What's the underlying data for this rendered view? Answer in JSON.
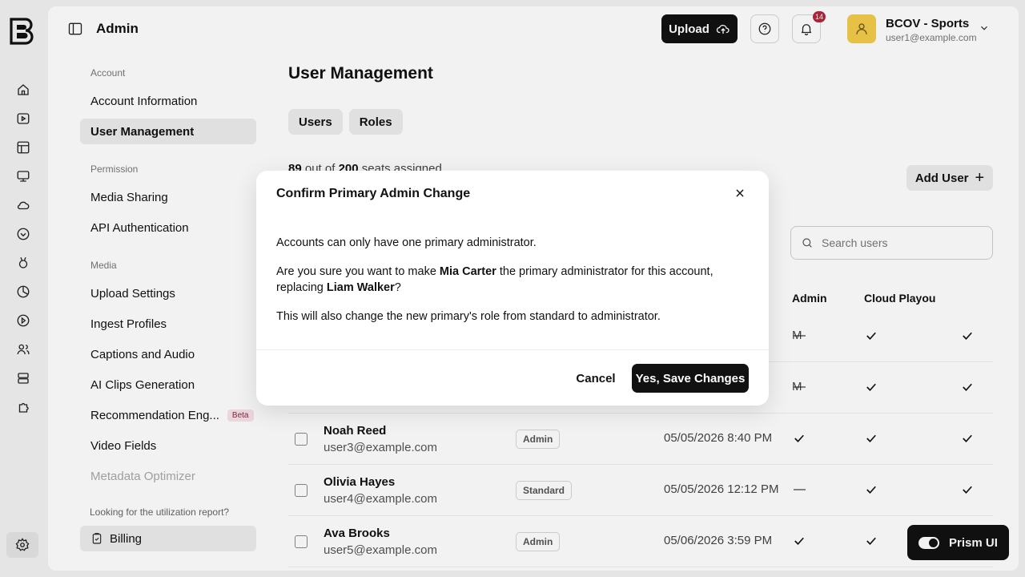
{
  "header": {
    "title": "Admin",
    "upload_label": "Upload",
    "notifications_count": "14",
    "account_name": "BCOV - Sports",
    "account_email": "user1@example.com"
  },
  "settings_nav": {
    "account_section": "Account",
    "account_information": "Account Information",
    "user_management": "User Management",
    "permission_section": "Permission",
    "media_sharing": "Media Sharing",
    "api_authentication": "API Authentication",
    "media_section": "Media",
    "upload_settings": "Upload Settings",
    "ingest_profiles": "Ingest Profiles",
    "captions_and_audio": "Captions and Audio",
    "ai_clips": "AI Clips Generation",
    "recommendation": "Recommendation Eng...",
    "beta_label": "Beta",
    "video_fields": "Video Fields",
    "metadata_optimizer": "Metadata Optimizer",
    "utilization_note": "Looking for the utilization report?",
    "billing": "Billing"
  },
  "main": {
    "page_title": "User Management",
    "tabs": [
      "Users",
      "Roles"
    ],
    "seats_assigned": "89",
    "seats_total": "200",
    "seats_prefix": "out of",
    "seats_suffix": "seats assigned",
    "add_user_label": "Add User",
    "search_placeholder": "Search users",
    "columns": {
      "admin": "Admin",
      "cloud_playout": "Cloud Playou"
    },
    "partial_rows": [
      {
        "date_tail": "M",
        "admin": "—"
      },
      {
        "date_tail": "M",
        "admin": "—"
      }
    ],
    "rows": [
      {
        "name": "Noah Reed",
        "email": "user3@example.com",
        "role": "Admin",
        "date": "05/05/2026 8:40 PM",
        "admin": true
      },
      {
        "name": "Olivia Hayes",
        "email": "user4@example.com",
        "role": "Standard",
        "date": "05/05/2026 12:12 PM",
        "admin": false
      },
      {
        "name": "Ava Brooks",
        "email": "user5@example.com",
        "role": "Admin",
        "date": "05/06/2026 3:59 PM",
        "admin": true
      }
    ],
    "dash": "—"
  },
  "prism": {
    "label": "Prism UI"
  },
  "modal": {
    "title": "Confirm Primary Admin Change",
    "line1": "Accounts can only have one primary administrator.",
    "line2_a": "Are you sure you want to make ",
    "new_admin": "Mia Carter",
    "line2_b": " the primary administrator for this account, replacing ",
    "old_admin": "Liam Walker",
    "line2_c": "?",
    "line3": "This will also change the new primary's role from standard to administrator.",
    "cancel_label": "Cancel",
    "confirm_label": "Yes, Save Changes"
  },
  "colors": {
    "accent": "#111111",
    "avatar": "#f3cc4a",
    "badge": "#b3263a",
    "beta_bg": "#f7e2e8"
  },
  "icons": {
    "rail": [
      "home-icon",
      "play-icon",
      "layout-icon",
      "monitor-icon",
      "cloud-icon",
      "shield-heart-icon",
      "medal-icon",
      "analytics-icon",
      "circle-play-icon",
      "users-icon",
      "server-icon",
      "puzzle-icon",
      "gear-icon"
    ]
  }
}
